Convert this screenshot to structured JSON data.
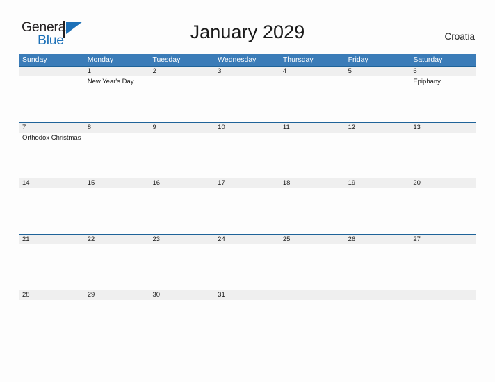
{
  "brand": {
    "word1": "General",
    "word2": "Blue",
    "mark_icon": "blue-flag-triangle-icon",
    "accent_color": "#1d71b8",
    "text_color": "#231f20"
  },
  "header": {
    "title": "January 2029",
    "region": "Croatia"
  },
  "theme": {
    "header_blue": "#3b7cb8",
    "separator_blue": "#1f6399",
    "date_band_gray": "#efefef",
    "page_background": "#fdfdfd"
  },
  "calendar": {
    "weekdays": [
      "Sunday",
      "Monday",
      "Tuesday",
      "Wednesday",
      "Thursday",
      "Friday",
      "Saturday"
    ],
    "weeks": [
      [
        {
          "date": "",
          "event": ""
        },
        {
          "date": "1",
          "event": "New Year's Day"
        },
        {
          "date": "2",
          "event": ""
        },
        {
          "date": "3",
          "event": ""
        },
        {
          "date": "4",
          "event": ""
        },
        {
          "date": "5",
          "event": ""
        },
        {
          "date": "6",
          "event": "Epiphany"
        }
      ],
      [
        {
          "date": "7",
          "event": "Orthodox Christmas"
        },
        {
          "date": "8",
          "event": ""
        },
        {
          "date": "9",
          "event": ""
        },
        {
          "date": "10",
          "event": ""
        },
        {
          "date": "11",
          "event": ""
        },
        {
          "date": "12",
          "event": ""
        },
        {
          "date": "13",
          "event": ""
        }
      ],
      [
        {
          "date": "14",
          "event": ""
        },
        {
          "date": "15",
          "event": ""
        },
        {
          "date": "16",
          "event": ""
        },
        {
          "date": "17",
          "event": ""
        },
        {
          "date": "18",
          "event": ""
        },
        {
          "date": "19",
          "event": ""
        },
        {
          "date": "20",
          "event": ""
        }
      ],
      [
        {
          "date": "21",
          "event": ""
        },
        {
          "date": "22",
          "event": ""
        },
        {
          "date": "23",
          "event": ""
        },
        {
          "date": "24",
          "event": ""
        },
        {
          "date": "25",
          "event": ""
        },
        {
          "date": "26",
          "event": ""
        },
        {
          "date": "27",
          "event": ""
        }
      ],
      [
        {
          "date": "28",
          "event": ""
        },
        {
          "date": "29",
          "event": ""
        },
        {
          "date": "30",
          "event": ""
        },
        {
          "date": "31",
          "event": ""
        },
        {
          "date": "",
          "event": ""
        },
        {
          "date": "",
          "event": ""
        },
        {
          "date": "",
          "event": ""
        }
      ]
    ]
  }
}
